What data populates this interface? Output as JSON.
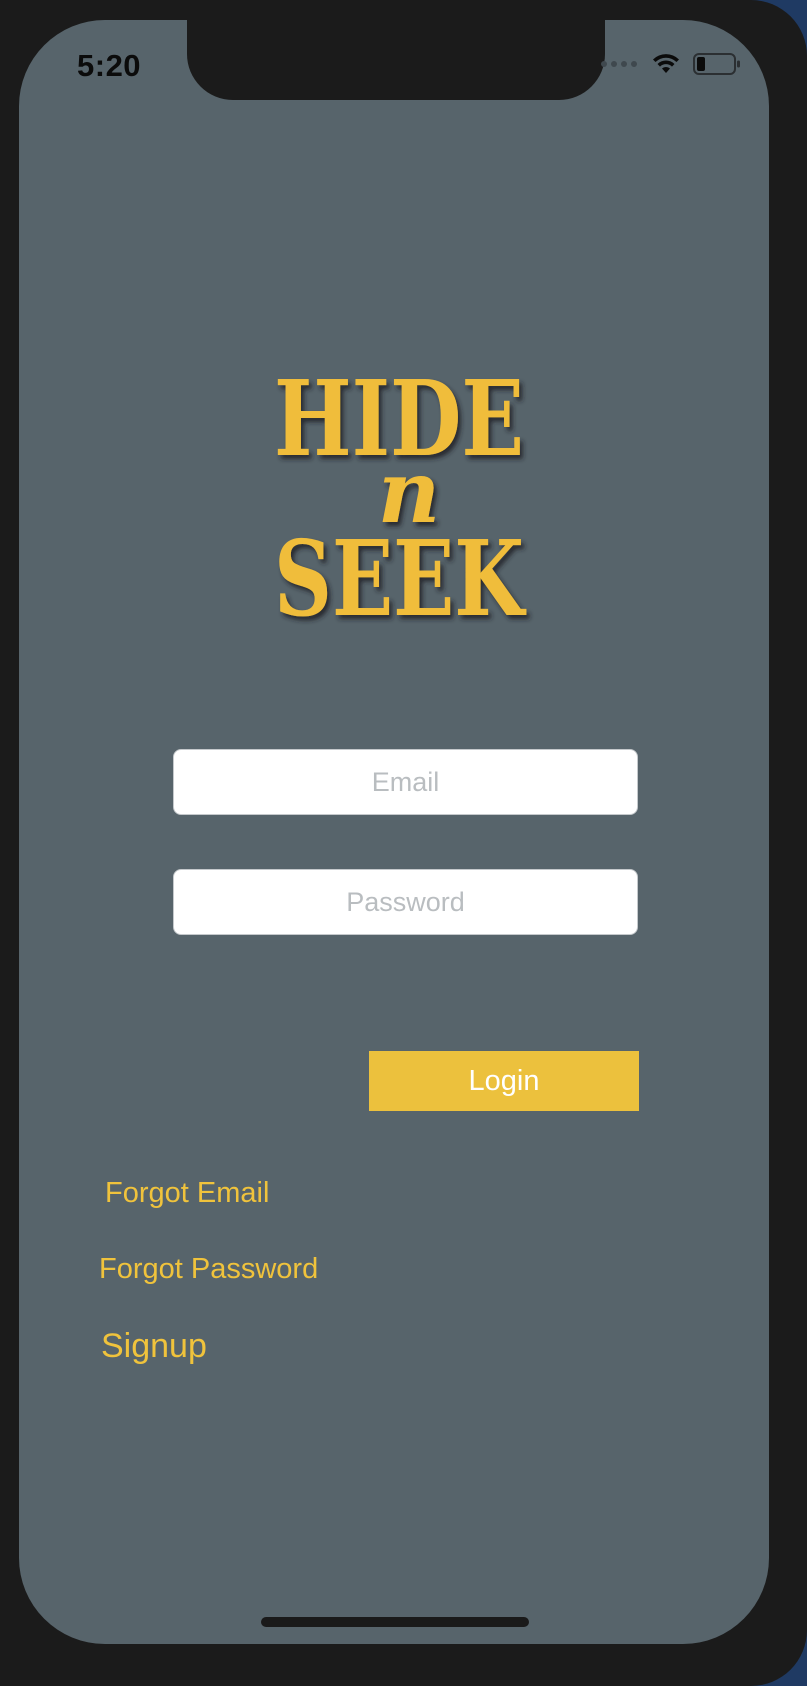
{
  "status_bar": {
    "time": "5:20"
  },
  "logo": {
    "line1": "HIDE",
    "line2": "n",
    "line3": "SEEK",
    "color": "#f0bd3a"
  },
  "form": {
    "email_placeholder": "Email",
    "email_value": "",
    "password_placeholder": "Password",
    "password_value": "",
    "login_label": "Login"
  },
  "links": {
    "forgot_email": "Forgot Email",
    "forgot_password": "Forgot Password",
    "signup": "Signup"
  },
  "colors": {
    "background": "#57646b",
    "accent": "#ecc13d",
    "link": "#f0c33c"
  },
  "icons": {
    "wifi": "wifi-icon",
    "battery": "battery-icon",
    "signal": "cellular-signal-icon"
  }
}
